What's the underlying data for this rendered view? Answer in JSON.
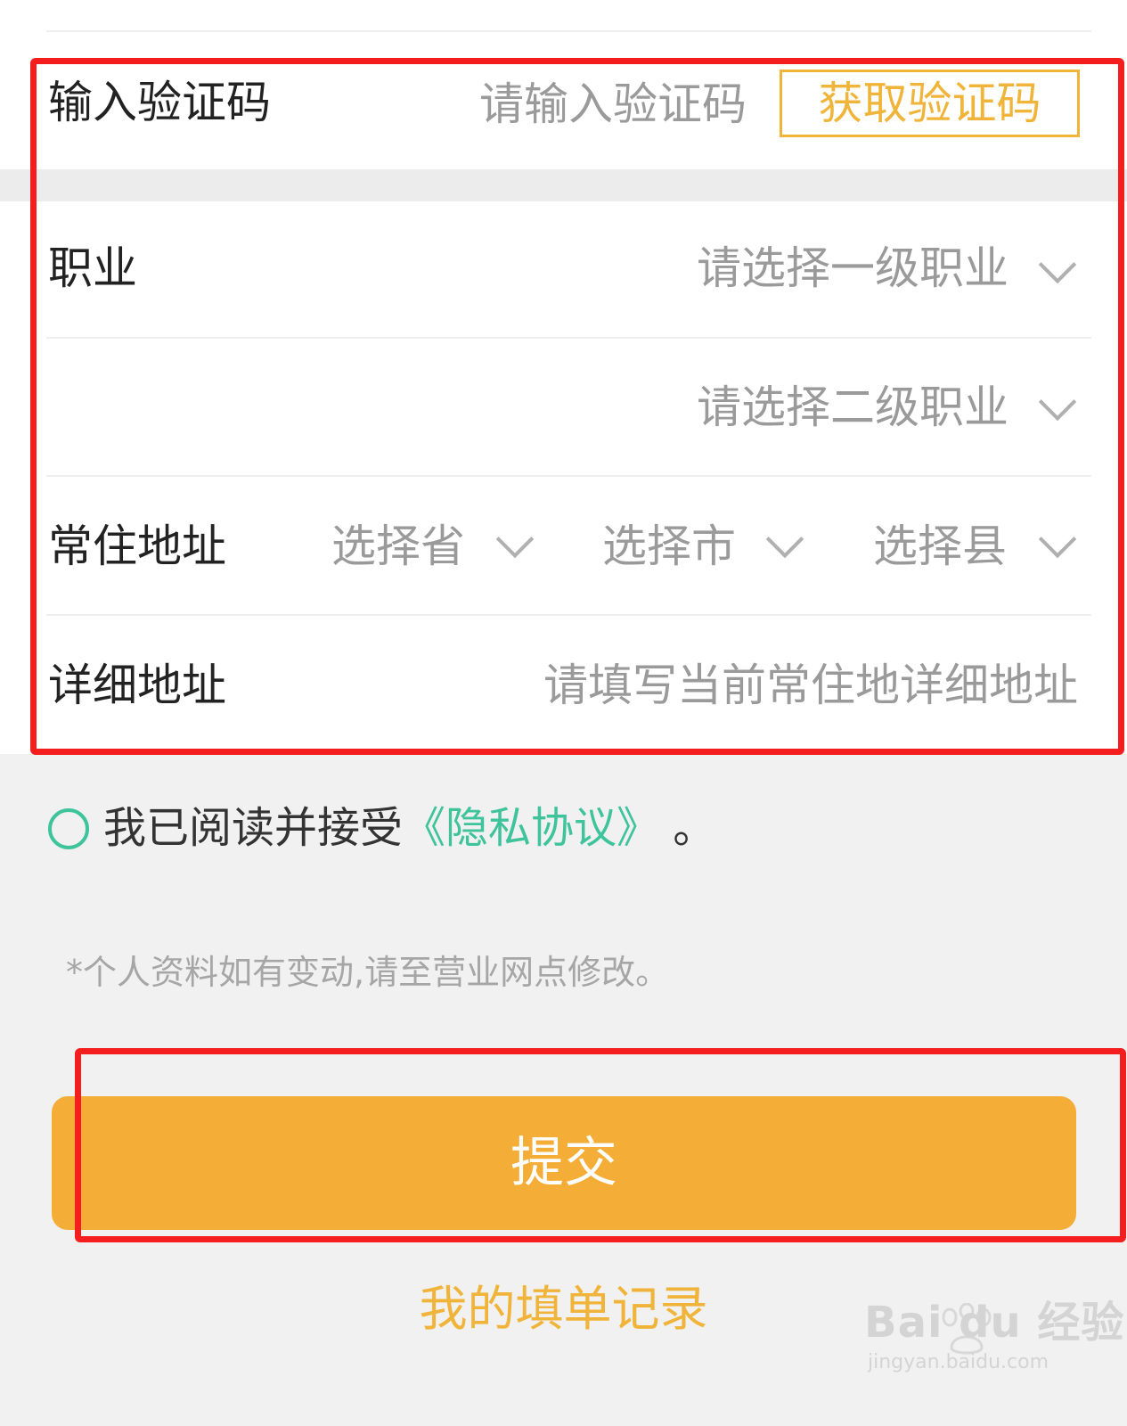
{
  "verify_row": {
    "label": "输入验证码",
    "placeholder": "请输入验证码",
    "get_code_label": "获取验证码"
  },
  "occupation": {
    "label": "职业",
    "level1_placeholder": "请选择一级职业",
    "level2_placeholder": "请选择二级职业"
  },
  "address": {
    "label": "常住地址",
    "province": "选择省",
    "city": "选择市",
    "county": "选择县"
  },
  "detail_address": {
    "label": "详细地址",
    "placeholder": "请填写当前常住地详细地址"
  },
  "agreement": {
    "prefix": "我已阅读并接受",
    "link": "《隐私协议》",
    "suffix": "。"
  },
  "note": "*个人资料如有变动,请至营业网点修改。",
  "submit_label": "提交",
  "records_label": "我的填单记录",
  "watermark": {
    "logo": "Bai du 经验",
    "url": "jingyan.baidu.com"
  },
  "colors": {
    "accent": "#f4ad36",
    "link": "#3fc39a",
    "highlight": "#f41e1e"
  }
}
